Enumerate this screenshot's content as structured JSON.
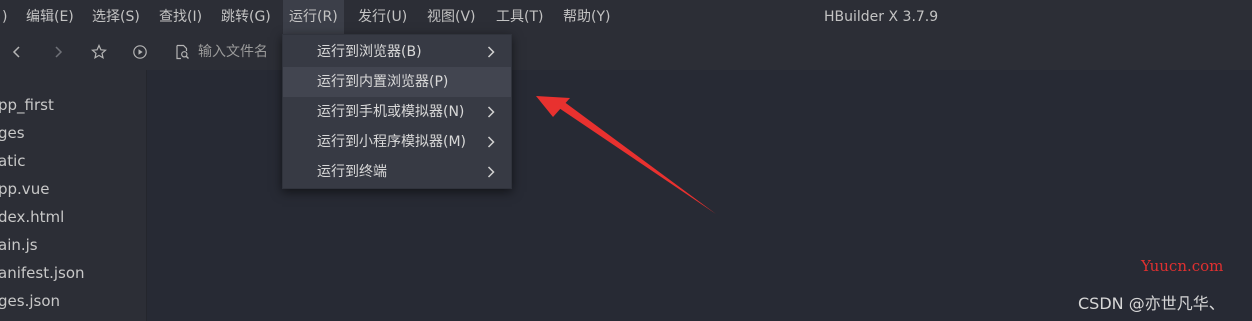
{
  "window": {
    "title": "HBuilder X 3.7.9"
  },
  "menubar": {
    "items": [
      {
        "label": "文件(F)",
        "partial": ")"
      },
      {
        "label": "编辑(E)"
      },
      {
        "label": "选择(S)"
      },
      {
        "label": "查找(I)"
      },
      {
        "label": "跳转(G)"
      },
      {
        "label": "运行(R)",
        "active": true
      },
      {
        "label": "发行(U)"
      },
      {
        "label": "视图(V)"
      },
      {
        "label": "工具(T)"
      },
      {
        "label": "帮助(Y)"
      }
    ],
    "first_fragment": ")"
  },
  "toolbar": {
    "icons": [
      "chevron-left-icon",
      "chevron-right-icon",
      "star-icon",
      "play-circle-icon",
      "file-search-icon"
    ],
    "search_placeholder": "输入文件名"
  },
  "sidebar": {
    "items": [
      "pp_first",
      "ges",
      "atic",
      "pp.vue",
      "dex.html",
      "ain.js",
      "anifest.json",
      "ges.json"
    ]
  },
  "run_menu": {
    "items": [
      {
        "label": "运行到浏览器(B)",
        "has_submenu": true
      },
      {
        "label": "运行到内置浏览器(P)",
        "has_submenu": false,
        "hovered": true
      },
      {
        "label": "运行到手机或模拟器(N)",
        "has_submenu": true
      },
      {
        "label": "运行到小程序模拟器(M)",
        "has_submenu": true
      },
      {
        "label": "运行到终端",
        "has_submenu": true
      }
    ]
  },
  "watermarks": {
    "site": "Yuucn.com",
    "author": "CSDN @亦世凡华、"
  },
  "colors": {
    "menubar_bg": "#2c2e36",
    "editor_bg": "#272a34",
    "dropdown_bg": "#373a44",
    "arrow": "#e8312f"
  }
}
